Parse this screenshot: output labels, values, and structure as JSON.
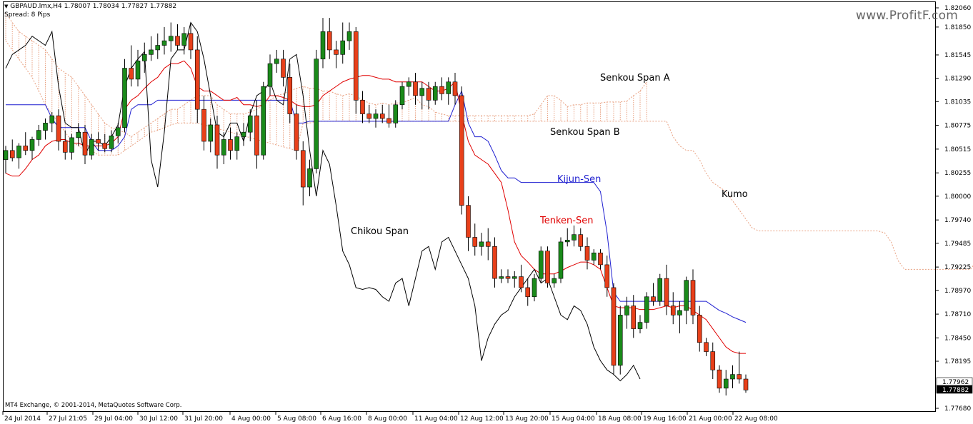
{
  "header": {
    "symbol_line": "GBPAUD.lmx,H4  1.78007 1.78034 1.77827 1.77882",
    "spread": "Spread: 8 Pips",
    "menu_icon": "triangle-down-icon"
  },
  "watermark": "www.ProfitF.com",
  "footer": "MT4 Exchange, © 2001-2014, MetaQuotes Software Corp.",
  "price_labels": {
    "current_ask": "1.77962",
    "current_bid": "1.77882"
  },
  "colors": {
    "bull": "#1a8a1a",
    "bear": "#e8401a",
    "tenkan": "#e00000",
    "kijun": "#1f1fd0",
    "chikou": "#000000",
    "cloud": "#e8a080"
  },
  "chart_data": {
    "type": "candlestick",
    "symbol": "GBPAUD.lmx",
    "timeframe": "H4",
    "ylim": [
      1.7768,
      1.8206
    ],
    "y_ticks": [
      "1.82060",
      "1.81850",
      "1.81545",
      "1.81290",
      "1.81035",
      "1.80775",
      "1.80515",
      "1.80255",
      "1.80000",
      "1.79740",
      "1.79485",
      "1.79225",
      "1.78970",
      "1.78710",
      "1.78450",
      "1.78195",
      "1.77680"
    ],
    "x_ticks": [
      "24 Jul 2014",
      "27 Jul 21:05",
      "29 Jul 04:00",
      "30 Jul 12:00",
      "31 Jul 20:00",
      "4 Aug 00:00",
      "5 Aug 08:00",
      "6 Aug 16:00",
      "8 Aug 00:00",
      "11 Aug 04:00",
      "12 Aug 12:00",
      "13 Aug 20:00",
      "15 Aug 04:00",
      "18 Aug 08:00",
      "19 Aug 16:00",
      "21 Aug 00:00",
      "22 Aug 08:00"
    ],
    "annotations": [
      "Senkou Span A",
      "Senkou Span B",
      "Kijun-Sen",
      "Tenken-Sen",
      "Kumo",
      "Chikou Span"
    ],
    "candles": [
      [
        1.804,
        1.8055,
        1.8025,
        1.805
      ],
      [
        1.805,
        1.8062,
        1.8038,
        1.8042
      ],
      [
        1.8042,
        1.8058,
        1.803,
        1.8055
      ],
      [
        1.8055,
        1.807,
        1.8045,
        1.805
      ],
      [
        1.805,
        1.8065,
        1.804,
        1.8062
      ],
      [
        1.8062,
        1.8078,
        1.8055,
        1.8072
      ],
      [
        1.8072,
        1.8085,
        1.8062,
        1.808
      ],
      [
        1.808,
        1.8092,
        1.807,
        1.8088
      ],
      [
        1.8088,
        1.8095,
        1.805,
        1.806
      ],
      [
        1.806,
        1.8072,
        1.804,
        1.8048
      ],
      [
        1.8048,
        1.8068,
        1.804,
        1.8064
      ],
      [
        1.8064,
        1.808,
        1.8055,
        1.807
      ],
      [
        1.807,
        1.8078,
        1.8035,
        1.8045
      ],
      [
        1.8045,
        1.8068,
        1.804,
        1.8062
      ],
      [
        1.8062,
        1.807,
        1.805,
        1.8058
      ],
      [
        1.8058,
        1.8068,
        1.8048,
        1.8052
      ],
      [
        1.8052,
        1.8072,
        1.8048,
        1.8066
      ],
      [
        1.8066,
        1.808,
        1.8058,
        1.8075
      ],
      [
        1.8075,
        1.815,
        1.807,
        1.814
      ],
      [
        1.814,
        1.8165,
        1.812,
        1.8128
      ],
      [
        1.8128,
        1.816,
        1.812,
        1.8148
      ],
      [
        1.8148,
        1.8168,
        1.8135,
        1.8155
      ],
      [
        1.8155,
        1.8175,
        1.8148,
        1.816
      ],
      [
        1.816,
        1.8178,
        1.815,
        1.8165
      ],
      [
        1.8165,
        1.8185,
        1.8155,
        1.817
      ],
      [
        1.817,
        1.819,
        1.8158,
        1.8175
      ],
      [
        1.8175,
        1.8188,
        1.816,
        1.8165
      ],
      [
        1.8165,
        1.8185,
        1.8155,
        1.8178
      ],
      [
        1.8178,
        1.819,
        1.815,
        1.816
      ],
      [
        1.816,
        1.8175,
        1.808,
        1.8095
      ],
      [
        1.8095,
        1.811,
        1.805,
        1.806
      ],
      [
        1.806,
        1.8085,
        1.8048,
        1.8078
      ],
      [
        1.8078,
        1.8088,
        1.803,
        1.8045
      ],
      [
        1.8045,
        1.807,
        1.8035,
        1.8062
      ],
      [
        1.8062,
        1.8075,
        1.804,
        1.805
      ],
      [
        1.805,
        1.807,
        1.804,
        1.8065
      ],
      [
        1.8065,
        1.808,
        1.8055,
        1.807
      ],
      [
        1.807,
        1.8095,
        1.806,
        1.8088
      ],
      [
        1.8088,
        1.8105,
        1.803,
        1.8045
      ],
      [
        1.8045,
        1.8125,
        1.804,
        1.812
      ],
      [
        1.812,
        1.8155,
        1.811,
        1.8145
      ],
      [
        1.8145,
        1.816,
        1.8135,
        1.815
      ],
      [
        1.815,
        1.816,
        1.812,
        1.813
      ],
      [
        1.813,
        1.8145,
        1.808,
        1.809
      ],
      [
        1.809,
        1.81,
        1.804,
        1.805
      ],
      [
        1.805,
        1.806,
        1.799,
        1.801
      ],
      [
        1.801,
        1.804,
        1.8,
        1.803
      ],
      [
        1.803,
        1.816,
        1.8025,
        1.815
      ],
      [
        1.815,
        1.8195,
        1.814,
        1.818
      ],
      [
        1.818,
        1.8195,
        1.815,
        1.816
      ],
      [
        1.816,
        1.817,
        1.814,
        1.8155
      ],
      [
        1.8155,
        1.819,
        1.8145,
        1.817
      ],
      [
        1.817,
        1.819,
        1.816,
        1.818
      ],
      [
        1.818,
        1.8185,
        1.809,
        1.8105
      ],
      [
        1.8105,
        1.8115,
        1.808,
        1.809
      ],
      [
        1.809,
        1.81,
        1.808,
        1.8085
      ],
      [
        1.8085,
        1.8095,
        1.8075,
        1.809
      ],
      [
        1.809,
        1.81,
        1.808,
        1.8085
      ],
      [
        1.8085,
        1.81,
        1.8075,
        1.808
      ],
      [
        1.808,
        1.8105,
        1.8075,
        1.81
      ],
      [
        1.81,
        1.8125,
        1.8095,
        1.812
      ],
      [
        1.812,
        1.813,
        1.811,
        1.8125
      ],
      [
        1.8125,
        1.8135,
        1.81,
        1.811
      ],
      [
        1.811,
        1.8125,
        1.8095,
        1.8118
      ],
      [
        1.8118,
        1.8125,
        1.8095,
        1.8105
      ],
      [
        1.8105,
        1.8125,
        1.81,
        1.812
      ],
      [
        1.812,
        1.813,
        1.8105,
        1.8112
      ],
      [
        1.8112,
        1.813,
        1.81,
        1.8125
      ],
      [
        1.8125,
        1.8135,
        1.81,
        1.811
      ],
      [
        1.811,
        1.812,
        1.798,
        1.799
      ],
      [
        1.799,
        1.8,
        1.794,
        1.7955
      ],
      [
        1.7955,
        1.797,
        1.7935,
        1.7945
      ],
      [
        1.7945,
        1.796,
        1.7935,
        1.795
      ],
      [
        1.795,
        1.7965,
        1.793,
        1.7945
      ],
      [
        1.7945,
        1.7955,
        1.79,
        1.791
      ],
      [
        1.791,
        1.792,
        1.7905,
        1.7912
      ],
      [
        1.7912,
        1.792,
        1.7905,
        1.791
      ],
      [
        1.791,
        1.7918,
        1.79,
        1.7912
      ],
      [
        1.7912,
        1.7925,
        1.7895,
        1.79
      ],
      [
        1.79,
        1.791,
        1.788,
        1.789
      ],
      [
        1.789,
        1.7915,
        1.7885,
        1.791
      ],
      [
        1.791,
        1.7945,
        1.7905,
        1.794
      ],
      [
        1.794,
        1.7945,
        1.79,
        1.7905
      ],
      [
        1.7905,
        1.7915,
        1.79,
        1.791
      ],
      [
        1.791,
        1.7955,
        1.7905,
        1.795
      ],
      [
        1.795,
        1.7965,
        1.7945,
        1.7952
      ],
      [
        1.7952,
        1.7968,
        1.7945,
        1.7958
      ],
      [
        1.7958,
        1.7965,
        1.794,
        1.7945
      ],
      [
        1.7945,
        1.7955,
        1.792,
        1.793
      ],
      [
        1.793,
        1.7942,
        1.7925,
        1.7938
      ],
      [
        1.7938,
        1.7942,
        1.792,
        1.7925
      ],
      [
        1.7925,
        1.7935,
        1.789,
        1.79
      ],
      [
        1.79,
        1.7905,
        1.7805,
        1.7815
      ],
      [
        1.7815,
        1.788,
        1.7805,
        1.787
      ],
      [
        1.787,
        1.789,
        1.7855,
        1.788
      ],
      [
        1.788,
        1.7892,
        1.7845,
        1.7855
      ],
      [
        1.7855,
        1.787,
        1.785,
        1.7862
      ],
      [
        1.7862,
        1.7895,
        1.7855,
        1.789
      ],
      [
        1.789,
        1.7905,
        1.788,
        1.7885
      ],
      [
        1.7885,
        1.7915,
        1.788,
        1.791
      ],
      [
        1.791,
        1.7925,
        1.787,
        1.788
      ],
      [
        1.788,
        1.7895,
        1.786,
        1.787
      ],
      [
        1.787,
        1.7885,
        1.785,
        1.7875
      ],
      [
        1.7875,
        1.7912,
        1.786,
        1.7908
      ],
      [
        1.7908,
        1.792,
        1.786,
        1.787
      ],
      [
        1.787,
        1.788,
        1.783,
        1.784
      ],
      [
        1.784,
        1.7845,
        1.7825,
        1.783
      ],
      [
        1.783,
        1.784,
        1.78,
        1.781
      ],
      [
        1.781,
        1.7815,
        1.7785,
        1.779
      ],
      [
        1.779,
        1.781,
        1.7782,
        1.78
      ],
      [
        1.78,
        1.7815,
        1.779,
        1.7805
      ],
      [
        1.7805,
        1.783,
        1.7795,
        1.78
      ],
      [
        1.78,
        1.7805,
        1.7785,
        1.7788
      ]
    ],
    "tenkan_sen": [
      1.8025,
      1.8022,
      1.8022,
      1.803,
      1.804,
      1.8045,
      1.8055,
      1.806,
      1.8062,
      1.8062,
      1.8058,
      1.8058,
      1.8055,
      1.8055,
      1.8055,
      1.8055,
      1.8058,
      1.8065,
      1.8095,
      1.8105,
      1.811,
      1.8118,
      1.8125,
      1.813,
      1.814,
      1.8145,
      1.8145,
      1.8148,
      1.814,
      1.812,
      1.8115,
      1.8115,
      1.811,
      1.8105,
      1.8105,
      1.8108,
      1.81,
      1.81,
      1.8098,
      1.81,
      1.811,
      1.811,
      1.8108,
      1.8105,
      1.81,
      1.8098,
      1.8098,
      1.81,
      1.811,
      1.8115,
      1.812,
      1.8125,
      1.8128,
      1.813,
      1.8132,
      1.8132,
      1.813,
      1.8128,
      1.8128,
      1.8125,
      1.8125,
      1.8125,
      1.8125,
      1.8125,
      1.812,
      1.8115,
      1.8115,
      1.8118,
      1.8125,
      1.809,
      1.806,
      1.8045,
      1.804,
      1.8035,
      1.8025,
      1.8015,
      1.7985,
      1.795,
      1.7935,
      1.7928,
      1.792,
      1.7915,
      1.7915,
      1.7915,
      1.7918,
      1.7922,
      1.7925,
      1.7928,
      1.7928,
      1.7925,
      1.792,
      1.79,
      1.788,
      1.7878,
      1.7878,
      1.7878,
      1.7876,
      1.7876,
      1.7876,
      1.7878,
      1.788,
      1.7878,
      1.788,
      1.788,
      1.7875,
      1.787,
      1.7865,
      1.7855,
      1.7845,
      1.7835,
      1.783,
      1.7828,
      1.7828
    ],
    "kijun_sen": [
      1.81,
      1.81,
      1.81,
      1.81,
      1.81,
      1.81,
      1.81,
      1.8085,
      1.8075,
      1.8075,
      1.8075,
      1.8075,
      1.8075,
      1.806,
      1.805,
      1.805,
      1.805,
      1.8055,
      1.8065,
      1.8095,
      1.81,
      1.81,
      1.81,
      1.8105,
      1.8105,
      1.8105,
      1.8105,
      1.8105,
      1.8105,
      1.8105,
      1.8105,
      1.8105,
      1.8105,
      1.8105,
      1.8105,
      1.8105,
      1.8105,
      1.8105,
      1.8105,
      1.8105,
      1.8105,
      1.8105,
      1.8105,
      1.8105,
      1.808,
      1.808,
      1.8082,
      1.8082,
      1.8082,
      1.8082,
      1.8082,
      1.8082,
      1.8082,
      1.8082,
      1.8082,
      1.8082,
      1.8082,
      1.8082,
      1.8082,
      1.8082,
      1.8082,
      1.8082,
      1.8082,
      1.8082,
      1.8082,
      1.8082,
      1.8082,
      1.8082,
      1.81,
      1.8115,
      1.808,
      1.8065,
      1.8065,
      1.806,
      1.8045,
      1.8028,
      1.802,
      1.802,
      1.8015,
      1.8015,
      1.8015,
      1.8015,
      1.8015,
      1.8015,
      1.8015,
      1.8015,
      1.8015,
      1.8015,
      1.8015,
      1.8015,
      1.8005,
      1.796,
      1.7895,
      1.7885,
      1.7885,
      1.7885,
      1.7885,
      1.7885,
      1.7885,
      1.7885,
      1.7885,
      1.7885,
      1.7885,
      1.7885,
      1.7885,
      1.7885,
      1.7885,
      1.788,
      1.7875,
      1.7872,
      1.7868,
      1.7865,
      1.7862
    ],
    "chikou_span": [
      1.814,
      1.8155,
      1.816,
      1.8165,
      1.8175,
      1.817,
      1.8165,
      1.818,
      1.812,
      1.808,
      1.8075,
      1.8075,
      1.8045,
      1.806,
      1.806,
      1.8055,
      1.8065,
      1.8078,
      1.812,
      1.814,
      1.815,
      1.8158,
      1.804,
      1.801,
      1.807,
      1.815,
      1.816,
      1.816,
      1.819,
      1.818,
      1.815,
      1.811,
      1.807,
      1.8065,
      1.808,
      1.808,
      1.806,
      1.809,
      1.811,
      1.8115,
      1.8125,
      1.8105,
      1.81,
      1.815,
      1.8155,
      1.811,
      1.805,
      1.8,
      1.805,
      1.8035,
      1.799,
      1.794,
      1.7925,
      1.79,
      1.7898,
      1.79,
      1.7898,
      1.789,
      1.7885,
      1.7905,
      1.791,
      1.788,
      1.791,
      1.794,
      1.7945,
      1.792,
      1.795,
      1.7955,
      1.794,
      1.7925,
      1.791,
      1.788,
      1.782,
      1.7845,
      1.786,
      1.787,
      1.7875,
      1.789,
      1.79,
      1.791,
      1.792,
      1.7905,
      1.791,
      1.789,
      1.787,
      1.7865,
      1.788,
      1.7875,
      1.786,
      1.7835,
      1.782,
      1.781,
      1.7805,
      1.7798,
      1.7805,
      1.7815,
      1.78
    ],
    "senkou_span_a": [
      1.82,
      1.819,
      1.818,
      1.8175,
      1.817,
      1.8165,
      1.816,
      1.815,
      1.814,
      1.8135,
      1.813,
      1.812,
      1.811,
      1.81,
      1.809,
      1.808,
      1.8075,
      1.8072,
      1.807,
      1.8065,
      1.807,
      1.8075,
      1.808,
      1.8085,
      1.809,
      1.8095,
      1.8095,
      1.81,
      1.8105,
      1.811,
      1.811,
      1.811,
      1.81,
      1.8095,
      1.809,
      1.809,
      1.809,
      1.8092,
      1.8095,
      1.81,
      1.8105,
      1.811,
      1.8112,
      1.8115,
      1.8118,
      1.812,
      1.8118,
      1.8118,
      1.8115,
      1.8115,
      1.8112,
      1.811,
      1.8112,
      1.811,
      1.8105,
      1.8102,
      1.81,
      1.8102,
      1.81,
      1.8102,
      1.8102,
      1.8105,
      1.8108,
      1.81,
      1.8098,
      1.8092,
      1.809,
      1.8088,
      1.8088,
      1.8088,
      1.8088,
      1.8088,
      1.8088,
      1.8088,
      1.8088,
      1.8088,
      1.8088,
      1.8088,
      1.8088,
      1.8088,
      1.809,
      1.81,
      1.811,
      1.811,
      1.8105,
      1.8098,
      1.81,
      1.81,
      1.8102,
      1.8102,
      1.8102,
      1.8103,
      1.8103,
      1.8103,
      1.8104,
      1.811,
      1.8115,
      1.8125
    ],
    "senkou_span_b": [
      1.817,
      1.816,
      1.815,
      1.814,
      1.813,
      1.8115,
      1.81,
      1.809,
      1.808,
      1.807,
      1.806,
      1.8055,
      1.805,
      1.805,
      1.8045,
      1.8045,
      1.8045,
      1.8045,
      1.805,
      1.8055,
      1.806,
      1.8065,
      1.807,
      1.8072,
      1.8075,
      1.8078,
      1.808,
      1.808,
      1.808,
      1.808,
      1.8078,
      1.8076,
      1.8074,
      1.8072,
      1.807,
      1.8068,
      1.8066,
      1.8064,
      1.8062,
      1.806,
      1.8058,
      1.8056,
      1.8054,
      1.8052,
      1.805,
      1.808,
      1.808,
      1.8082,
      1.8082,
      1.8082,
      1.8082,
      1.8082,
      1.8082,
      1.8082,
      1.8082,
      1.8082,
      1.8082,
      1.8082,
      1.8082,
      1.8082,
      1.8082,
      1.8082,
      1.8082,
      1.8082,
      1.8082,
      1.8082,
      1.8082,
      1.8082,
      1.8082,
      1.8082,
      1.8082,
      1.8082,
      1.8082,
      1.8082,
      1.8082,
      1.8082,
      1.8082,
      1.8082,
      1.8082,
      1.8082,
      1.8082,
      1.8082,
      1.8082,
      1.8082,
      1.8082,
      1.8082,
      1.8082,
      1.8082,
      1.8082,
      1.8082,
      1.8082,
      1.8082,
      1.8082,
      1.8082,
      1.8082,
      1.8082,
      1.8082,
      1.8082,
      1.8082,
      1.8082,
      1.8082,
      1.8065,
      1.8055,
      1.805,
      1.805,
      1.804,
      1.8025,
      1.8015,
      1.801,
      1.8005,
      1.7995,
      1.7985,
      1.7975,
      1.7965,
      1.7962,
      1.7962,
      1.7962,
      1.7962,
      1.7962,
      1.7962,
      1.7962,
      1.7962,
      1.7962,
      1.7962,
      1.7962,
      1.7962,
      1.7962,
      1.7962,
      1.7962,
      1.7962,
      1.7962,
      1.7962,
      1.7962,
      1.796,
      1.795,
      1.793,
      1.792,
      1.792,
      1.792,
      1.792,
      1.792,
      1.792,
      1.792,
      1.792,
      1.792,
      1.792,
      1.792,
      1.793,
      1.796,
      1.796
    ]
  }
}
